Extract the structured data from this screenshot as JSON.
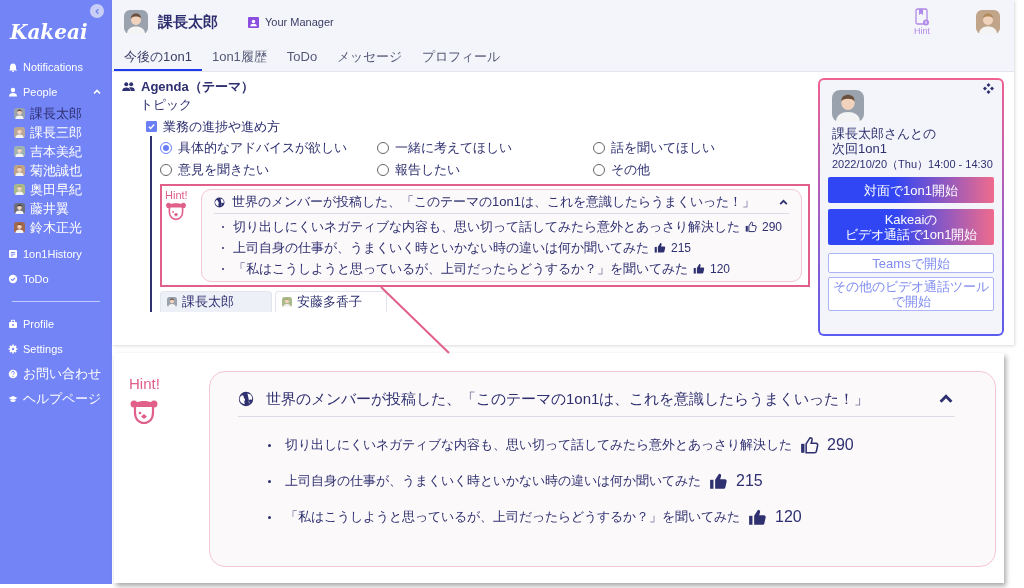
{
  "sidebar": {
    "logo": "Kakeai",
    "nav": [
      {
        "label": "Notifications"
      },
      {
        "label": "People",
        "expanded": true,
        "children": [
          {
            "name": "課長太郎",
            "selected": true
          },
          {
            "name": "課長三郎",
            "selected": false
          },
          {
            "name": "吉本美紀",
            "selected": false
          },
          {
            "name": "菊池誠也",
            "selected": false
          },
          {
            "name": "奥田早紀",
            "selected": false
          },
          {
            "name": "藤井翼",
            "selected": false
          },
          {
            "name": "鈴木正光",
            "selected": false
          }
        ]
      },
      {
        "label": "1on1History"
      },
      {
        "label": "ToDo"
      }
    ],
    "footer_nav": [
      {
        "label": "Profile"
      },
      {
        "label": "Settings"
      },
      {
        "label": "お問い合わせ"
      },
      {
        "label": "ヘルプページ"
      }
    ]
  },
  "header": {
    "name": "課長太郎",
    "badge": "Your Manager",
    "hint_label": "Hint"
  },
  "tabs": [
    {
      "label": "今後の1on1",
      "selected": true
    },
    {
      "label": "1on1履歴",
      "selected": false
    },
    {
      "label": "ToDo",
      "selected": false
    },
    {
      "label": "メッセージ",
      "selected": false
    },
    {
      "label": "プロフィール",
      "selected": false
    }
  ],
  "agenda": {
    "title": "Agenda（テーマ）",
    "subtitle": "トピック",
    "topic": {
      "label": "業務の進捗や進め方",
      "checked": true
    },
    "options": [
      {
        "label": "具体的なアドバイスが欲しい",
        "selected": true
      },
      {
        "label": "一緒に考えてほしい",
        "selected": false
      },
      {
        "label": "話を聞いてほしい",
        "selected": false
      },
      {
        "label": "意見を聞きたい",
        "selected": false
      },
      {
        "label": "報告したい",
        "selected": false
      },
      {
        "label": "その他",
        "selected": false
      }
    ],
    "hint": {
      "label": "Hint!",
      "title": "世界のメンバーが投稿した、「このテーマの1on1は、これを意識したらうまくいった！」",
      "expanded": true,
      "items": [
        {
          "text": "切り出しにくいネガティブな内容も、思い切って話してみたら意外とあっさり解決した",
          "count": "290",
          "liked": false
        },
        {
          "text": "上司自身の仕事が、うまくいく時といかない時の違いは何か聞いてみた",
          "count": "215",
          "liked": true
        },
        {
          "text": "「私はこうしようと思っているが、上司だったらどうするか？」を聞いてみた",
          "count": "120",
          "liked": true
        }
      ]
    },
    "person_tabs": [
      {
        "name": "課長太郎",
        "selected": true
      },
      {
        "name": "安藤多香子",
        "selected": false
      }
    ]
  },
  "next_meeting": {
    "lines": [
      "課長太郎さんとの",
      "次回1on1"
    ],
    "datetime": "2022/10/20（Thu）14:00 - 14:30",
    "buttons": [
      {
        "kind": "primary",
        "lines": [
          "対面で1on1開始"
        ]
      },
      {
        "kind": "primary",
        "lines": [
          "Kakeaiの",
          "ビデオ通話で1on1開始"
        ]
      },
      {
        "kind": "outline",
        "lines": [
          "Teamsで開始"
        ]
      },
      {
        "kind": "outline",
        "lines": [
          "その他のビデオ通話ツールで開始"
        ]
      }
    ]
  },
  "callout": {
    "label": "Hint!",
    "title": "世界のメンバーが投稿した、「このテーマの1on1は、これを意識したらうまくいった！」",
    "expanded": true,
    "items": [
      {
        "text": "切り出しにくいネガティブな内容も、思い切って話してみたら意外とあっさり解決した",
        "count": "290",
        "liked": false
      },
      {
        "text": "上司自身の仕事が、うまくいく時といかない時の違いは何か聞いてみた",
        "count": "215",
        "liked": true
      },
      {
        "text": "「私はこうしようと思っているが、上司だったらどうするか？」を聞いてみた",
        "count": "120",
        "liked": true
      }
    ]
  }
}
